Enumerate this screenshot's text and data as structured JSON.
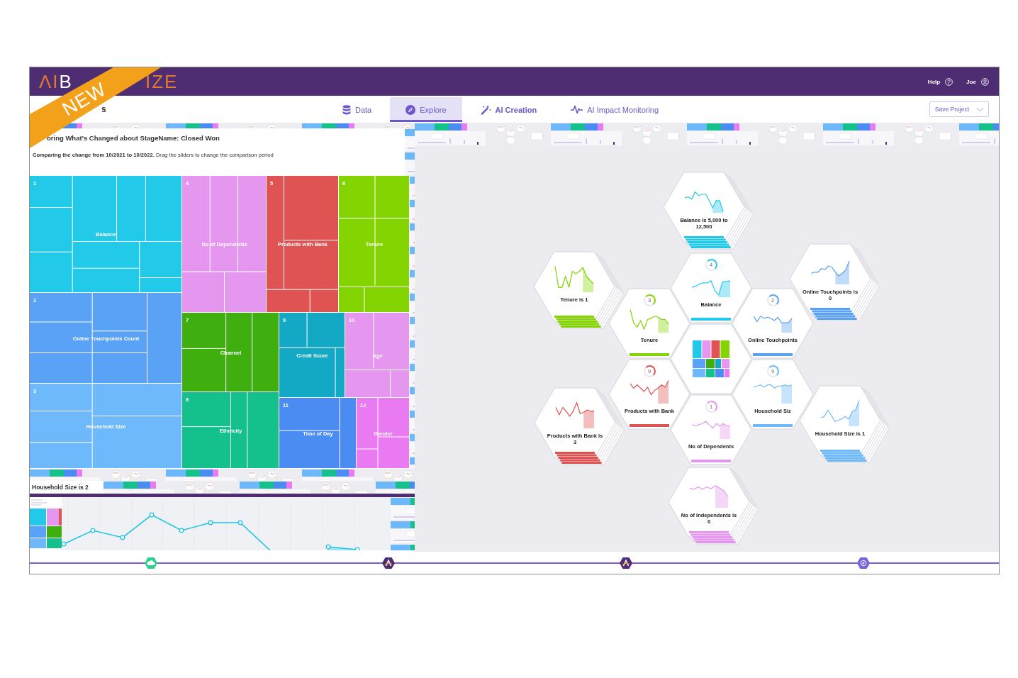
{
  "header": {
    "logo": {
      "mark": "ΛI",
      "word_start": "B",
      "word_end": "IZE"
    },
    "ribbon": "NEW",
    "links": [
      {
        "label": "Help"
      },
      {
        "label": "Joe"
      }
    ]
  },
  "nav": {
    "title": "s",
    "tabs": [
      {
        "label": "Data",
        "selected": false,
        "highlighted": false
      },
      {
        "label": "Explore",
        "selected": true,
        "highlighted": false
      },
      {
        "label": "AI Creation",
        "selected": false,
        "highlighted": true
      },
      {
        "label": "AI Impact Monitoring",
        "selected": false,
        "highlighted": false
      }
    ],
    "save_button": "Save Project"
  },
  "analysis": {
    "title": "oring What’s Changed about StageName: Closed Won",
    "subtitle": "**Comparing the change from 10/2021 to 10/2022.** Drag the sliders to change the comparison period",
    "treemap": {
      "tiles": [
        {
          "number": "1",
          "label": "Balance",
          "color": "#23c9e9"
        },
        {
          "number": "2",
          "label": "Online Touchpoints Count",
          "color": "#5aa2f5"
        },
        {
          "number": "3",
          "label": "Household Size",
          "color": "#6db9fb"
        },
        {
          "number": "4",
          "label": "No of Dependents",
          "color": "#e597ef"
        },
        {
          "number": "5",
          "label": "Products with Bank",
          "color": "#e05353"
        },
        {
          "number": "6",
          "label": "Tenure",
          "color": "#84d402"
        },
        {
          "number": "7",
          "label": "Channel",
          "color": "#3faf10"
        },
        {
          "number": "8",
          "label": "Ethnicity",
          "color": "#14c08b"
        },
        {
          "number": "9",
          "label": "Credit Score",
          "color": "#13a9c4"
        },
        {
          "number": "10",
          "label": "Age",
          "color": "#e597ef"
        },
        {
          "number": "11",
          "label": "Time of Day",
          "color": "#4a8cf1"
        },
        {
          "number": "12",
          "label": "Gender",
          "color": "#e97af1"
        }
      ]
    },
    "segment_title": "Household Size is 2"
  },
  "hexes": [
    {
      "kind": "metric",
      "label": "Balance is 5,000 to 12,500",
      "color": "#23c9e9",
      "stacked": true
    },
    {
      "kind": "metric",
      "label": "Online Touchpoints is 0",
      "color": "#5aa2f5",
      "stacked": true
    },
    {
      "kind": "metric",
      "label": "Tenure is 1",
      "color": "#84d402",
      "stacked": true
    },
    {
      "kind": "metric",
      "label": "Balance",
      "badge": "4",
      "color": "#23c9e9",
      "stacked": false
    },
    {
      "kind": "metric",
      "label": "Tenure",
      "badge": "3",
      "color": "#84d402",
      "stacked": false
    },
    {
      "kind": "metric",
      "label": "Online Touchpoints",
      "badge": "2",
      "color": "#5aa2f5",
      "stacked": false
    },
    {
      "kind": "treemap"
    },
    {
      "kind": "metric",
      "label": "Products with Bank",
      "badge": "9",
      "color": "#e05353",
      "stacked": false
    },
    {
      "kind": "metric",
      "label": "Household Siz",
      "badge": "9",
      "color": "#6db9fb",
      "stacked": false
    },
    {
      "kind": "metric",
      "label": "No of Dependents",
      "badge": "1",
      "color": "#e597ef",
      "stacked": false
    },
    {
      "kind": "metric",
      "label": "Products with Bank is 3",
      "color": "#e05353",
      "stacked": true
    },
    {
      "kind": "metric",
      "label": "Household Size is 1",
      "color": "#6db9fb",
      "stacked": true
    },
    {
      "kind": "metric",
      "label": "No of Independents is 0",
      "color": "#e597ef",
      "stacked": true
    }
  ]
}
